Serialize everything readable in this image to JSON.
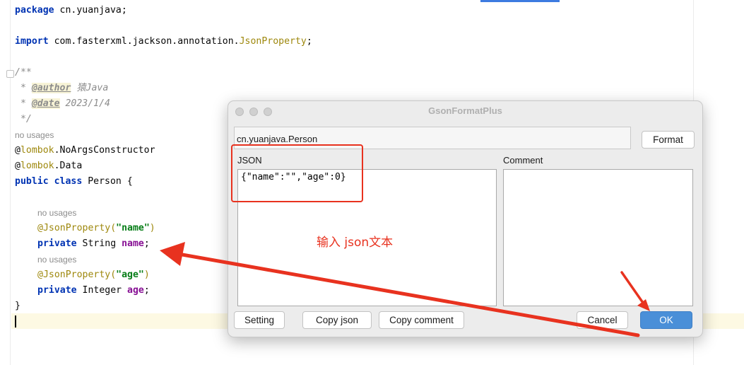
{
  "editor": {
    "hint_no_usages": "no usages",
    "lines": {
      "package": {
        "kw": "package",
        "rest": " cn.yuanjava;"
      },
      "import": {
        "kw": "import",
        "rest": " com.fasterxml.jackson.annotation.",
        "cls": "JsonProperty",
        "end": ";"
      },
      "doc_open": "/**",
      "doc_author": {
        "prefix": " * ",
        "tag": "@author",
        "value": " 猿Java"
      },
      "doc_date": {
        "prefix": " * ",
        "tag": "@date",
        "value": " 2023/1/4"
      },
      "doc_close": " */",
      "ann1": {
        "at": "@",
        "name": "lombok",
        "rest": ".NoArgsConstructor"
      },
      "ann2": {
        "at": "@",
        "name": "lombok",
        "rest": ".Data"
      },
      "class_decl": {
        "kw1": "public",
        "kw2": "class",
        "rest": " Person {"
      },
      "json_prop_name": {
        "ann": "@JsonProperty(",
        "str": "\"name\"",
        "end": ")"
      },
      "field_name": {
        "kw": "private",
        "type": " String ",
        "field": "name",
        "end": ";"
      },
      "json_prop_age": {
        "ann": "@JsonProperty(",
        "str": "\"age\"",
        "end": ")"
      },
      "field_age": {
        "kw": "private",
        "type": " Integer ",
        "field": "age",
        "end": ";"
      },
      "close_brace": "}"
    }
  },
  "dialog": {
    "title": "GsonFormatPlus",
    "class_name": "cn.yuanjava.Person",
    "format_label": "Format",
    "json_label": "JSON",
    "json_text": "{\"name\":\"\",\"age\":0}",
    "comment_label": "Comment",
    "comment_text": "",
    "buttons": {
      "setting": "Setting",
      "copy_json": "Copy  json",
      "copy_comment": "Copy comment",
      "cancel": "Cancel",
      "ok": "OK"
    }
  },
  "annotation": {
    "text": "输入 json文本",
    "color": "#e8321f"
  }
}
